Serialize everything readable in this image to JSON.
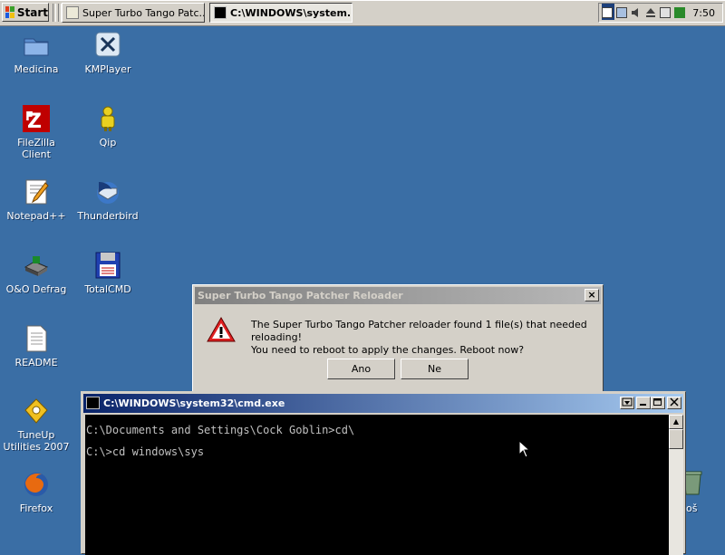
{
  "taskbar": {
    "start_label": "Start",
    "tasks": [
      {
        "label": "Super Turbo Tango Patc...",
        "active": false
      },
      {
        "label": "C:\\WINDOWS\\system...",
        "active": true
      }
    ],
    "clock": "7:50"
  },
  "desktop_icons": [
    {
      "label": "Medicina",
      "icon": "folder-icon"
    },
    {
      "label": "KMPlayer",
      "icon": "kmplayer-icon"
    },
    {
      "label": "FileZilla Client",
      "icon": "filezilla-icon"
    },
    {
      "label": "Qip",
      "icon": "qip-icon"
    },
    {
      "label": "Notepad++",
      "icon": "notepad-icon"
    },
    {
      "label": "Thunderbird",
      "icon": "thunderbird-icon"
    },
    {
      "label": "O&O Defrag",
      "icon": "defrag-icon"
    },
    {
      "label": "TotalCMD",
      "icon": "floppy-icon"
    },
    {
      "label": "README",
      "icon": "document-icon"
    },
    {
      "label": "TuneUp Utilities 2007",
      "icon": "tuneup-icon"
    },
    {
      "label": "Firefox",
      "icon": "firefox-icon"
    },
    {
      "label": "oš",
      "icon": "recycle-bin-icon"
    }
  ],
  "dialog": {
    "title": "Super Turbo Tango Patcher Reloader",
    "message_line1": "The Super Turbo Tango Patcher reloader found 1 file(s) that needed reloading!",
    "message_line2": "You need to reboot to apply the changes. Reboot now?",
    "yes_label": "Ano",
    "no_label": "Ne",
    "close_label": "×"
  },
  "console": {
    "title": "C:\\WINDOWS\\system32\\cmd.exe",
    "lines": [
      "C:\\Documents and Settings\\Cock Goblin>cd\\",
      "C:\\>cd windows\\sys"
    ]
  }
}
